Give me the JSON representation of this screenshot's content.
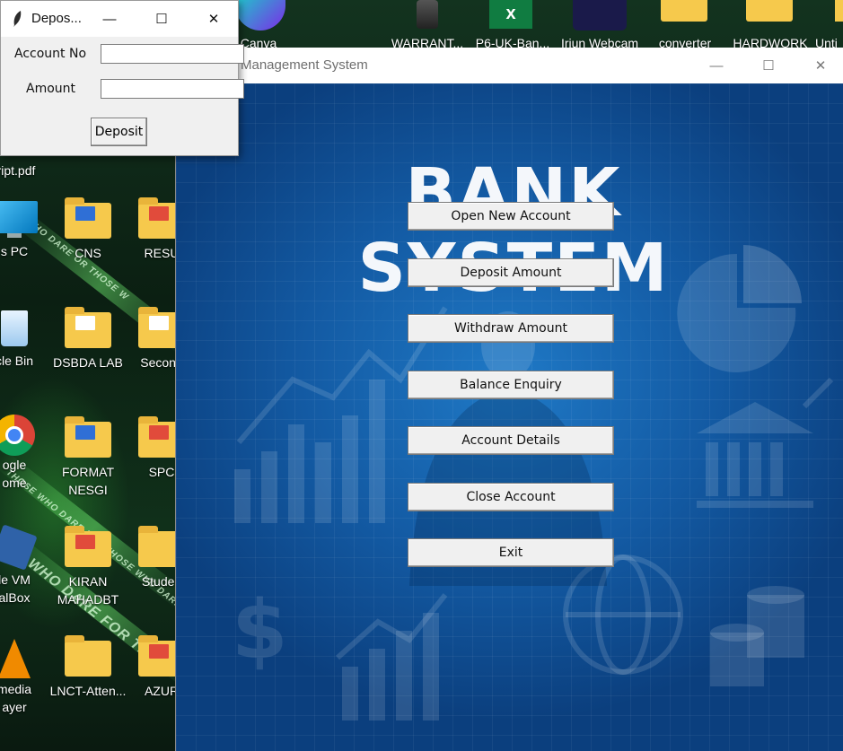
{
  "desktop": {
    "top_icons": [
      {
        "label": "Canva"
      },
      {
        "label": "WARRANT..."
      },
      {
        "label": "P6-UK-Ban..."
      },
      {
        "label": "Iriun Webcam"
      },
      {
        "label": "converter"
      },
      {
        "label": "HARDWORK"
      },
      {
        "label": "Unti"
      }
    ],
    "left_icons": [
      {
        "label": "ript.pdf"
      },
      {
        "label": "s PC"
      },
      {
        "label": "CNS"
      },
      {
        "label": "RESU"
      },
      {
        "label": "cle Bin"
      },
      {
        "label": "DSBDA LAB"
      },
      {
        "label": "Second"
      },
      {
        "label": "ogle"
      },
      {
        "label": "ome"
      },
      {
        "label": "FORMAT"
      },
      {
        "label": "NESGI"
      },
      {
        "label": "SPC"
      },
      {
        "label": "le VM"
      },
      {
        "label": "alBox"
      },
      {
        "label": "KIRAN"
      },
      {
        "label": "MAHADBT"
      },
      {
        "label": "Studen"
      },
      {
        "label": "media"
      },
      {
        "label": "ayer"
      },
      {
        "label": "LNCT-Atten..."
      },
      {
        "label": "AZUR"
      }
    ],
    "wallpaper_text": [
      "WHO DARE OR THOSE W",
      "THOSE WHO DARE FOR THOSE WHO DARE",
      "SE WHO DARE FOR TH"
    ]
  },
  "main_window": {
    "title": "Management System",
    "headline": "BANK SYSTEM",
    "buttons": [
      "Open New Account",
      "Deposit Amount",
      "Withdraw Amount",
      "Balance Enquiry",
      "Account Details",
      "Close Account",
      "Exit"
    ],
    "controls": {
      "minimize": "—",
      "maximize": "☐",
      "close": "✕"
    }
  },
  "deposit_dialog": {
    "title": "Depos...",
    "account_label": "Account No",
    "account_value": "",
    "amount_label": "Amount",
    "amount_value": "",
    "submit_label": "Deposit",
    "controls": {
      "minimize": "—",
      "maximize": "☐",
      "close": "✕"
    }
  },
  "colors": {
    "bank_bg": "#135aa3",
    "headline": "#f4f7fb",
    "button_face": "#f0f0f0",
    "folder": "#f6c94c"
  }
}
